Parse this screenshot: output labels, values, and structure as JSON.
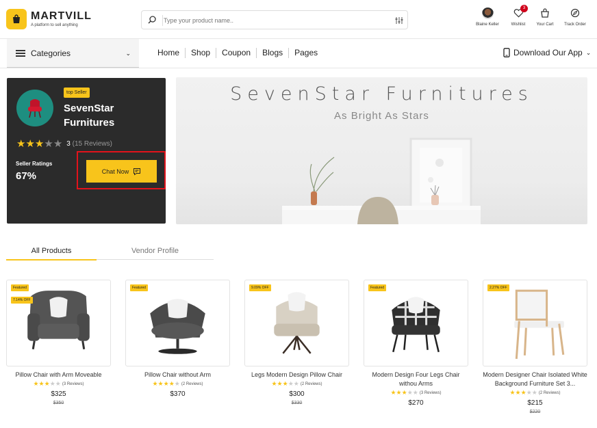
{
  "brand": {
    "name": "MARTVILL",
    "tagline": "A platform to sell anything"
  },
  "search": {
    "placeholder": "Type your product name.."
  },
  "header_actions": [
    {
      "label": "Blaine Keller",
      "icon": "avatar"
    },
    {
      "label": "Wishlist",
      "icon": "heart-icon",
      "badge": "3"
    },
    {
      "label": "Your Cart",
      "icon": "cart-icon"
    },
    {
      "label": "Track Order",
      "icon": "compass-icon"
    }
  ],
  "nav": {
    "categories": "Categories",
    "links": [
      "Home",
      "Shop",
      "Coupon",
      "Blogs",
      "Pages"
    ],
    "download": "Download Our App"
  },
  "seller": {
    "badge": "top Seller",
    "name": "SevenStar Furnitures",
    "rating": "3",
    "reviews": "(15 Reviews)",
    "ratings_label": "Seller Ratings",
    "ratings_value": "67%",
    "chat": "Chat Now",
    "stars": 3
  },
  "banner": {
    "title": "SevenStar Furnitures",
    "subtitle": "As Bright As Stars"
  },
  "tabs": [
    "All Products",
    "Vendor Profile"
  ],
  "products": [
    {
      "tags": [
        "Featured",
        "7.14% OFF"
      ],
      "name": "Pillow Chair with Arm Moveable",
      "stars": 3,
      "reviews": "(3 Reviews)",
      "price": "$325",
      "old": "$350"
    },
    {
      "tags": [
        "Featured"
      ],
      "name": "Pillow Chair without Arm",
      "stars": 4,
      "reviews": "(2 Reviews)",
      "price": "$370",
      "old": ""
    },
    {
      "tags": [
        "9.09% OFF"
      ],
      "name": "Legs Modern Design Pillow Chair",
      "stars": 3,
      "reviews": "(2 Reviews)",
      "price": "$300",
      "old": "$330"
    },
    {
      "tags": [
        "Featured"
      ],
      "name": "Modern Design Four Legs Chair withou Arms",
      "stars": 3,
      "reviews": "(3 Reviews)",
      "price": "$270",
      "old": ""
    },
    {
      "tags": [
        "2.27% OFF"
      ],
      "name": "Modern Designer Chair Isolated White Background Furniture Set 3...",
      "stars": 3,
      "reviews": "(2 Reviews)",
      "price": "$215",
      "old": "$220"
    }
  ],
  "colors": {
    "accent": "#f8c41b",
    "dark": "#2b2b2b",
    "highlight": "#e3131b"
  }
}
